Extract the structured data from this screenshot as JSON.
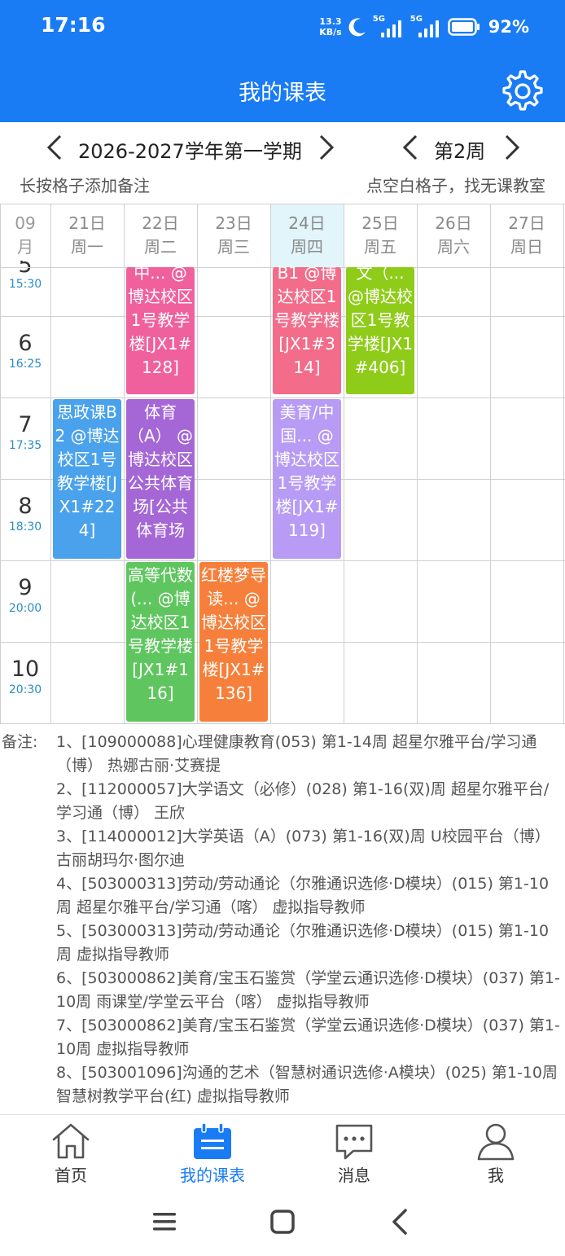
{
  "status": {
    "time": "17:16",
    "net_speed_value": "13.3",
    "net_speed_unit": "KB/s",
    "signal1": "5G",
    "signal2": "5G",
    "battery": "92%"
  },
  "header": {
    "title": "我的课表",
    "settings_icon": "gear-icon"
  },
  "term": {
    "label": "2026-2027学年第一学期",
    "week": "第2周"
  },
  "hints": {
    "left": "长按格子添加备注",
    "right": "点空白格子，找无课教室"
  },
  "grid": {
    "month": [
      "09",
      "月"
    ],
    "days": [
      {
        "date": "21日",
        "weekday": "周一"
      },
      {
        "date": "22日",
        "weekday": "周二"
      },
      {
        "date": "23日",
        "weekday": "周三"
      },
      {
        "date": "24日",
        "weekday": "周四",
        "today": true
      },
      {
        "date": "25日",
        "weekday": "周五"
      },
      {
        "date": "26日",
        "weekday": "周六"
      },
      {
        "date": "27日",
        "weekday": "周日"
      }
    ],
    "periods": [
      {
        "num": "5",
        "time": "15:30"
      },
      {
        "num": "6",
        "time": "16:25"
      },
      {
        "num": "7",
        "time": "17:35"
      },
      {
        "num": "8",
        "time": "18:30"
      },
      {
        "num": "9",
        "time": "20:00"
      },
      {
        "num": "10",
        "time": "20:30"
      }
    ],
    "courses": [
      {
        "day": 1,
        "start": 0,
        "span": 2,
        "text": "中... @博达校区1号教学楼[JX1#128]",
        "color": "#f0609c"
      },
      {
        "day": 3,
        "start": 0,
        "span": 2,
        "text": "B1 @博达校区1号教学楼[JX1#314]",
        "color": "#f36d8b"
      },
      {
        "day": 4,
        "start": 0,
        "span": 2,
        "text": "文（... @博达校区1号教学楼[JX1#406]",
        "color": "#8fcc19"
      },
      {
        "day": 0,
        "start": 2,
        "span": 2,
        "text": "思政课B2 @博达校区1号教学楼[JX1#224]",
        "color": "#4aa2ec"
      },
      {
        "day": 1,
        "start": 2,
        "span": 2,
        "text": "体育（A） @博达校区公共体育场[公共体育场",
        "color": "#a567d6"
      },
      {
        "day": 3,
        "start": 2,
        "span": 2,
        "text": "美育/中国... @博达校区1号教学楼[JX1#119]",
        "color": "#b89bf5"
      },
      {
        "day": 1,
        "start": 4,
        "span": 2,
        "text": "高等代数(... @博达校区1号教学楼[JX1#116]",
        "color": "#5fc65f"
      },
      {
        "day": 2,
        "start": 4,
        "span": 2,
        "text": "红楼梦导读... @博达校区1号教学楼[JX1#136]",
        "color": "#f6803b"
      }
    ]
  },
  "notes": {
    "label": "备注:",
    "items": [
      "1、[109000088]心理健康教育(053) 第1-14周 超星尔雅平台/学习通（博） 热娜古丽·艾赛提",
      "2、[112000057]大学语文（必修）(028) 第1-16(双)周 超星尔雅平台/学习通（博） 王欣",
      "3、[114000012]大学英语（A）(073) 第1-16(双)周 U校园平台（博） 古丽胡玛尔·图尔迪",
      "4、[503000313]劳动/劳动通论（尔雅通识选修·D模块）(015) 第1-10周 超星尔雅平台/学习通（喀） 虚拟指导教师",
      "5、[503000313]劳动/劳动通论（尔雅通识选修·D模块）(015) 第1-10周 虚拟指导教师",
      "6、[503000862]美育/宝玉石鉴赏（学堂云通识选修·D模块）(037) 第1-10周 雨课堂/学堂云平台（喀） 虚拟指导教师",
      "7、[503000862]美育/宝玉石鉴赏（学堂云通识选修·D模块）(037) 第1-10周 虚拟指导教师",
      "8、[503001096]沟通的艺术（智慧树通识选修·A模块）(025) 第1-10周 智慧树教学平台(红) 虚拟指导教师"
    ]
  },
  "nav": {
    "items": [
      {
        "label": "首页",
        "icon": "home-icon"
      },
      {
        "label": "我的课表",
        "icon": "calendar-icon",
        "active": true
      },
      {
        "label": "消息",
        "icon": "message-icon"
      },
      {
        "label": "我",
        "icon": "user-icon"
      }
    ]
  },
  "colors": {
    "brand": "#1a7cf5",
    "today_bg": "#e2f5fb",
    "time_text": "#2a8cc7"
  }
}
